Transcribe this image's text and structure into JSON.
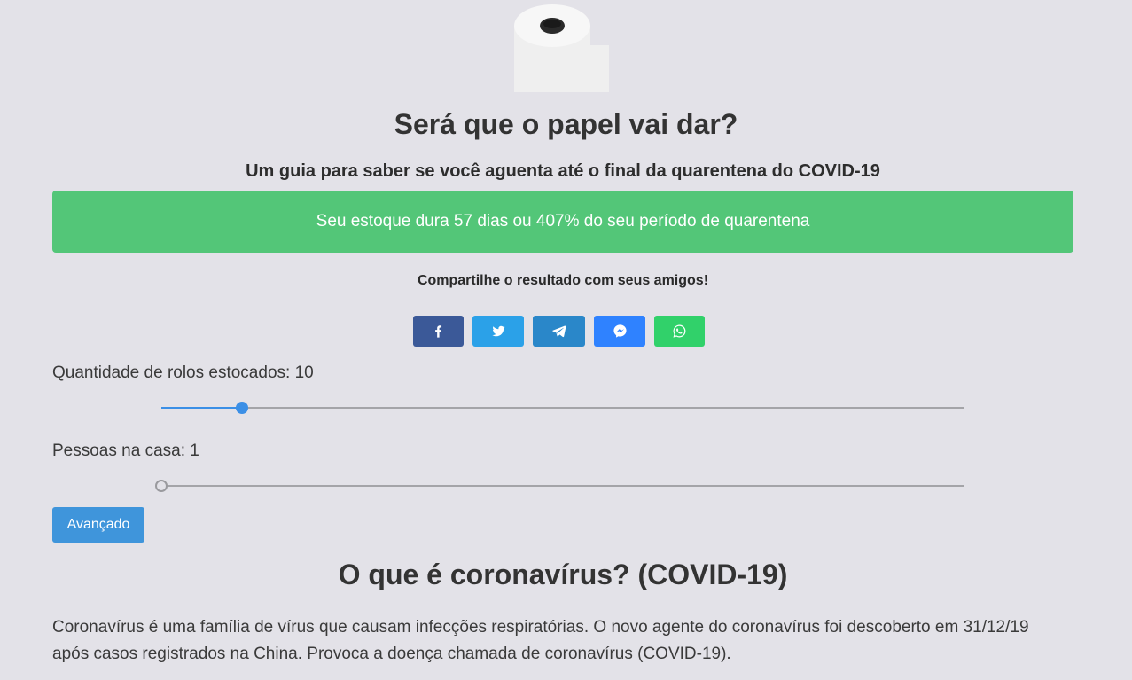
{
  "header": {
    "logo_icon": "toilet-paper-icon",
    "title": "Será que o papel vai dar?",
    "subtitle": "Um guia para saber se você aguenta até o final da quarentena do COVID-19"
  },
  "result": {
    "text": "Seu estoque dura 57 dias ou 407% do seu período de quarentena",
    "color": "#53c678"
  },
  "share": {
    "prompt": "Compartilhe o resultado com seus amigos!",
    "buttons": [
      {
        "icon": "facebook-icon",
        "color": "#3b5998"
      },
      {
        "icon": "twitter-icon",
        "color": "#2ba1e8"
      },
      {
        "icon": "telegram-icon",
        "color": "#2a87c9"
      },
      {
        "icon": "messenger-icon",
        "color": "#2f82ff"
      },
      {
        "icon": "whatsapp-icon",
        "color": "#31d16a"
      }
    ]
  },
  "controls": {
    "rolls": {
      "label": "Quantidade de rolos estocados: 10",
      "value": 10,
      "level": 0.1
    },
    "people": {
      "label": "Pessoas na casa: 1",
      "value": 1,
      "level": 0
    },
    "advanced_label": "Avançado"
  },
  "info": {
    "title": "O que é coronavírus? (COVID-19)",
    "paragraph": "Coronavírus é uma família de vírus que causam infecções respiratórias. O novo agente do coronavírus foi descoberto em 31/12/19 após casos registrados na China. Provoca a doença chamada de coronavírus (COVID-19)."
  },
  "colors": {
    "background": "#e3e2e8",
    "accent": "#3b8fe6",
    "button": "#3f95db"
  }
}
